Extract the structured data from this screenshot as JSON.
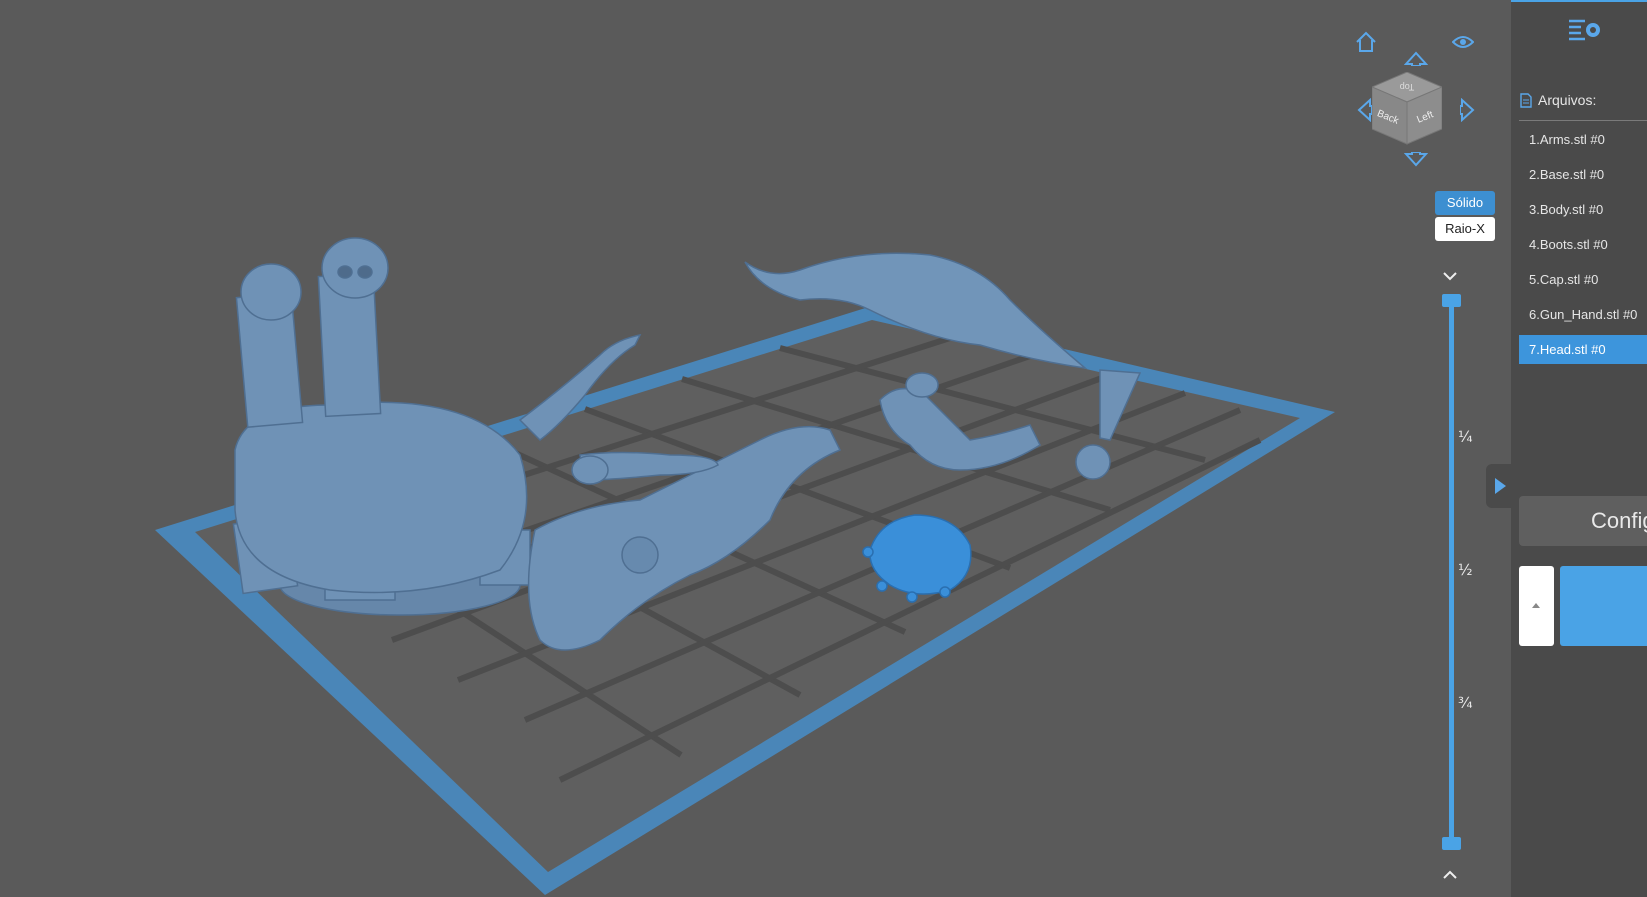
{
  "viewport": {
    "view_modes": {
      "solid": "Sólido",
      "xray": "Raio-X"
    },
    "cube_faces": {
      "top": "Top",
      "back": "Back",
      "left": "Left"
    },
    "layer_slider": {
      "marks": [
        "¼",
        "½",
        "¾"
      ],
      "position_top": 0,
      "position_bottom": 1
    }
  },
  "panel": {
    "files_label": "Arquivos:",
    "files": [
      {
        "label": "1.Arms.stl #0"
      },
      {
        "label": "2.Base.stl #0"
      },
      {
        "label": "3.Body.stl #0"
      },
      {
        "label": "4.Boots.stl #0"
      },
      {
        "label": "5.Cap.stl #0"
      },
      {
        "label": "6.Gun_Hand.stl #0"
      },
      {
        "label": "7.Head.stl #0",
        "selected": true
      }
    ],
    "config_button": "Config"
  },
  "colors": {
    "background": "#5a5a5a",
    "accent": "#4aa3e6",
    "model": "#6f92b6",
    "selected_model": "#3a8fd9",
    "plate_border": "#4a86b8"
  },
  "icons": [
    "home-icon",
    "eye-icon",
    "arrow-up-icon",
    "arrow-left-icon",
    "arrow-right-icon",
    "arrow-down-icon",
    "settings-list-icon",
    "file-icon",
    "chevron-down-icon",
    "chevron-up-icon",
    "play-right-icon",
    "caret-up-icon"
  ]
}
